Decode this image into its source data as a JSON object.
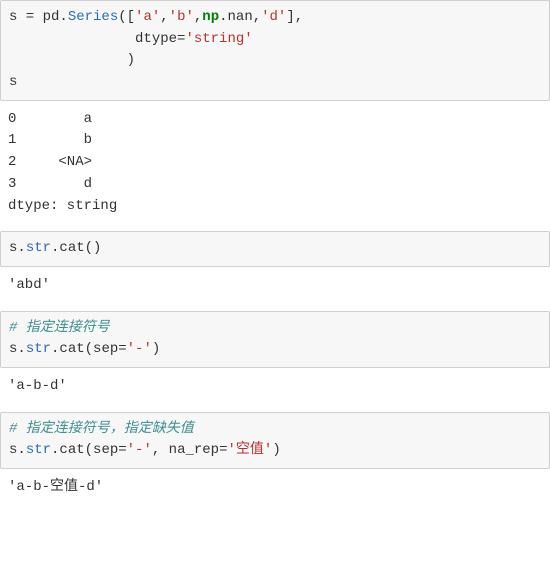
{
  "cell1": {
    "code": {
      "l1": {
        "a": "s = pd.",
        "b": "Series",
        "c": "([",
        "d": "'a'",
        "e": ",",
        "f": "'b'",
        "g": ",",
        "h": "np",
        "i": ".nan,",
        "j": "'d'",
        "k": "],"
      },
      "l2": {
        "a": "               dtype=",
        "b": "'string'"
      },
      "l3": {
        "a": "              )"
      },
      "l4": {
        "a": "s"
      }
    },
    "output": "0        a\n1        b\n2     <NA>\n3        d\ndtype: string"
  },
  "cell2": {
    "code": {
      "a": "s.",
      "b": "str",
      "c": ".cat()"
    },
    "output": "'abd'"
  },
  "cell3": {
    "code": {
      "c1": {
        "a": "# 指定连接符号"
      },
      "l1": {
        "a": "s.",
        "b": "str",
        "c": ".cat(sep=",
        "d": "'-'",
        "e": ")"
      }
    },
    "output": "'a-b-d'"
  },
  "cell4": {
    "code": {
      "c1": {
        "a": "# 指定连接符号，指定缺失值"
      },
      "l1": {
        "a": "s.",
        "b": "str",
        "c": ".cat(sep=",
        "d": "'-'",
        "e": ", na_rep=",
        "f": "'空值'",
        "g": ")"
      }
    },
    "output": "'a-b-空值-d'"
  }
}
